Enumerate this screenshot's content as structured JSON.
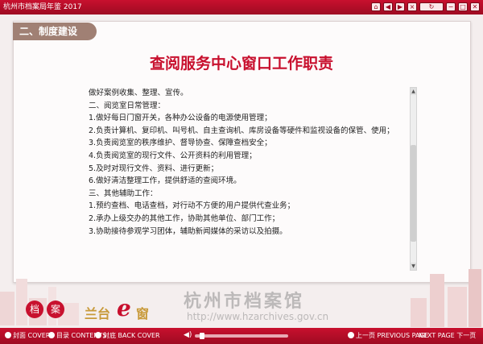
{
  "window": {
    "title": "杭州市档案局年鉴 2017",
    "controls": [
      "⌂",
      "◀",
      "▶",
      "×",
      "↻",
      "−",
      "□",
      "✕"
    ]
  },
  "section": {
    "label": "二、制度建设"
  },
  "document": {
    "title": "查阅服务中心窗口工作职责",
    "lines": [
      "做好案例收集、整理、宣传。",
      "二、阅览室日常管理：",
      "1.做好每日门窗开关，各种办公设备的电源使用管理；",
      "2.负责计算机、复印机、叫号机、自主查询机、库房设备等硬件和监视设备的保管、使用；",
      "3.负责阅览室的秩序维护、督导协查、保障查档安全；",
      "4.负责阅览室的现行文件、公开资料的利用管理；",
      "5.及时对现行文件、资料、进行更新；",
      "6.做好清洁整理工作，提供舒适的查阅环境。",
      "三、其他辅助工作：",
      "1.预约查档、电话查档，对行动不方便的用户提供代查业务；",
      "2.承办上级交办的其他工作，协助其他单位、部门工作；",
      "3.协助接待参观学习团体，辅助新闻媒体的采访以及拍摄。"
    ],
    "scroll_position": 0.7
  },
  "branding": {
    "logo_glyphs": [
      "档",
      "案"
    ],
    "brand_pre": "兰台",
    "brand_e": "e",
    "brand_post": "窗",
    "archive_name": "杭州市档案馆",
    "archive_url": "http://www.hzarchives.gov.cn"
  },
  "navbar": {
    "cover": "封面 COVER",
    "contents": "目录 CONTENTS",
    "back_cover": "封底 BACK COVER",
    "audio_speaker": "◀)",
    "audio_level": 0.05,
    "previous": "上一页 PREVIOUS PAGE",
    "next": "NEXT PAGE 下一页"
  }
}
